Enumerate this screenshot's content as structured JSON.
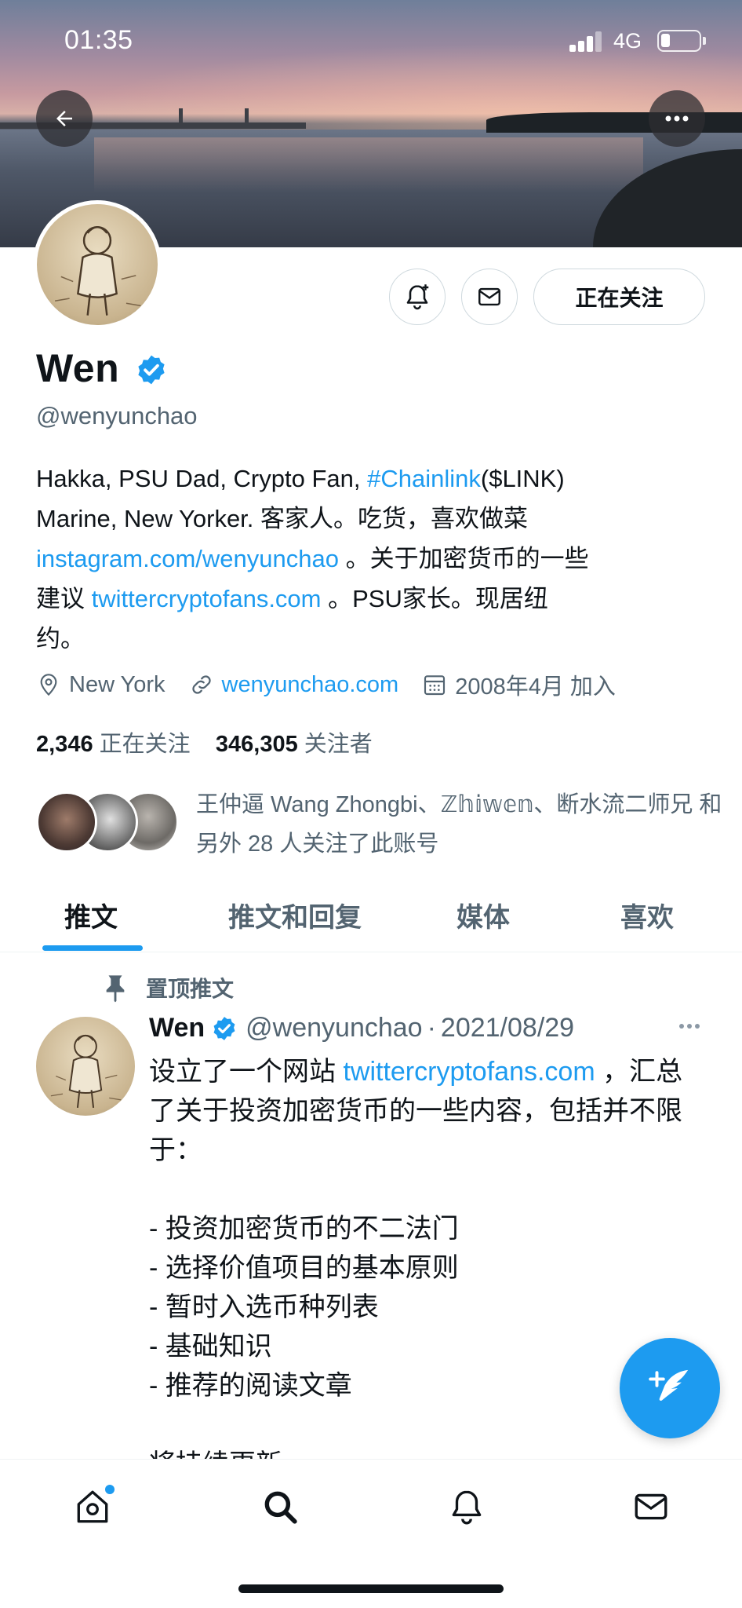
{
  "status_bar": {
    "time": "01:35",
    "network": "4G"
  },
  "profile": {
    "display_name": "Wen",
    "handle": "@wenyunchao",
    "follow_button": "正在关注",
    "bio": {
      "line1_text": "Hakka, PSU Dad, Crypto Fan, ",
      "line1_hashtag": "#Chainlink",
      "line1_tail": "($LINK)",
      "line2": "Marine, New Yorker. 客家人。吃货，喜欢做菜",
      "line3_link": "instagram.com/wenyunchao",
      "line3_tail": " 。关于加密货币的一些",
      "line4_head": "建议 ",
      "line4_link": "twittercryptofans.com",
      "line4_tail": " 。PSU家长。现居纽",
      "line5": "约。"
    },
    "location": "New York",
    "website": "wenyunchao.com",
    "joined": "2008年4月 加入",
    "following_count": "2,346",
    "following_label": "正在关注",
    "followers_count": "346,305",
    "followers_label": "关注者",
    "followed_by_text": "王仲逼 Wang Zhongbi、ℤ𝕙𝕚𝕨𝕖𝕟、断水流二师兄 和另外 28 人关注了此账号"
  },
  "tabs": [
    {
      "label": "推文",
      "active": true
    },
    {
      "label": "推文和回复",
      "active": false
    },
    {
      "label": "媒体",
      "active": false
    },
    {
      "label": "喜欢",
      "active": false
    }
  ],
  "pinned_tweet": {
    "pinned_label": "置顶推文",
    "author_name": "Wen",
    "author_handle": "@wenyunchao",
    "date_sep": "·",
    "date": "2021/08/29",
    "body_head": "设立了一个网站 ",
    "body_link": "twittercryptofans.com",
    "body_rest": " ，汇总了关于投资加密货币的一些内容，包括并不限于：\n\n- 投资加密货币的不二法门\n- 选择价值项目的基本原则\n- 暂时入选币种列表\n- 基础知识\n- 推荐的阅读文章\n\n将持续更新"
  },
  "colors": {
    "accent": "#1d9bf0",
    "text": "#0f1419",
    "muted": "#536471",
    "border": "#cfd9de"
  },
  "icons": [
    "back-arrow-icon",
    "more-icon",
    "bell-plus-icon",
    "mail-icon",
    "location-icon",
    "link-icon",
    "calendar-icon",
    "verified-icon",
    "pin-icon",
    "compose-icon",
    "home-icon",
    "search-icon",
    "notifications-icon",
    "messages-icon"
  ]
}
